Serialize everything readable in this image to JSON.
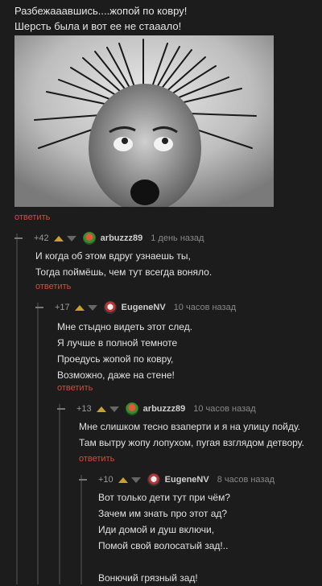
{
  "post": {
    "text_line1": "Разбежааавшись....жопой по ковру!",
    "text_line2": "Шерсть была и вот ее не стаaало!",
    "reply_label": "ответить"
  },
  "comments": [
    {
      "rating": "+42",
      "user": "arbuzzz89",
      "time": "1 день назад",
      "lines": [
        "И когда об этом вдруг узнаешь ты,",
        "Тогда поймёшь, чем тут всегда воняло."
      ],
      "reply_label": "ответить",
      "avatar_icon": "watermelon-avatar"
    },
    {
      "rating": "+17",
      "user": "EugeneNV",
      "time": "10 часов назад",
      "lines": [
        "Мне стыдно видеть этот след.",
        "Я лучше в полной темноте",
        "Проедусь жопой по ковру,",
        "Возможно, даже на стене!"
      ],
      "reply_label": "ответить",
      "avatar_icon": "cartoon-avatar"
    },
    {
      "rating": "+13",
      "user": "arbuzzz89",
      "time": "10 часов назад",
      "lines": [
        "Мне слишком тесно взаперти и я на улицу пойду.",
        "Там вытру жопу лопухом, пугая взглядом детвору."
      ],
      "reply_label": "ответить",
      "avatar_icon": "watermelon-avatar"
    },
    {
      "rating": "+10",
      "user": "EugeneNV",
      "time": "8 часов назад",
      "lines": [
        "Вот только дети тут при чём?",
        "Зачем им знать про этот ад?",
        "Иди домой и душ включи,",
        "Помой свой волосатый зад!..",
        "",
        "Вонючий грязный зад!"
      ],
      "avatar_icon": "cartoon-avatar"
    }
  ],
  "colors": {
    "accent": "#d94a3a",
    "upvote": "#c8a12e",
    "background": "#1c1c1c"
  }
}
